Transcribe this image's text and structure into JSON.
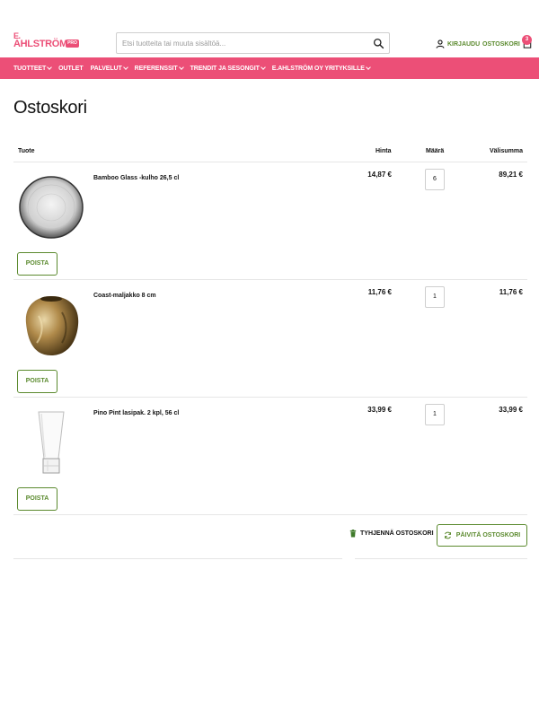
{
  "brand": {
    "logo_top": "E.",
    "logo_main": "AHLSTRÖM",
    "logo_badge": "PRO",
    "color": "#ec4f77"
  },
  "search": {
    "placeholder": "Etsi tuotteita tai muuta sisältöä..."
  },
  "account": {
    "login_label": "KIRJAUDU",
    "cart_label": "OSTOSKORI",
    "cart_count": "3"
  },
  "nav": {
    "items": [
      {
        "label": "TUOTTEET",
        "has_dropdown": true
      },
      {
        "label": "OUTLET",
        "has_dropdown": false
      },
      {
        "label": "PALVELUT",
        "has_dropdown": true
      },
      {
        "label": "REFERENSSIT",
        "has_dropdown": true
      },
      {
        "label": "TRENDIT JA SESONGIT",
        "has_dropdown": true
      },
      {
        "label": "E.AHLSTRÖM OY YRITYKSILLE",
        "has_dropdown": true
      }
    ]
  },
  "page": {
    "title": "Ostoskori"
  },
  "table": {
    "headers": {
      "product": "Tuote",
      "price": "Hinta",
      "quantity": "Määrä",
      "subtotal": "Välisumma"
    },
    "rows": [
      {
        "name": "Bamboo Glass -kulho 26,5 cl",
        "price": "14,87 €",
        "quantity": "6",
        "subtotal": "89,21 €",
        "remove_label": "POISTA",
        "image": "glass-bowl"
      },
      {
        "name": "Coast-maljakko 8 cm",
        "price": "11,76 €",
        "quantity": "1",
        "subtotal": "11,76 €",
        "remove_label": "POISTA",
        "image": "gold-vase"
      },
      {
        "name": "Pino Pint lasipak. 2 kpl, 56 cl",
        "price": "33,99 €",
        "quantity": "1",
        "subtotal": "33,99 €",
        "remove_label": "POISTA",
        "image": "pint-glass"
      }
    ]
  },
  "actions": {
    "empty_cart_label": "TYHJENNÄ OSTOSKORI",
    "update_cart_label": "PÄIVITÄ OSTOSKORI"
  },
  "colors": {
    "accent_pink": "#ec4f77",
    "accent_green": "#5b8a2e"
  }
}
